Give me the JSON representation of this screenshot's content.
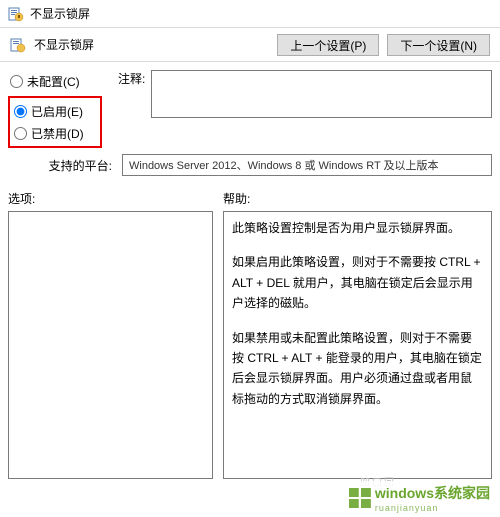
{
  "window": {
    "title": "不显示锁屏",
    "policy_name": "不显示锁屏"
  },
  "nav": {
    "prev": "上一个设置(P)",
    "next": "下一个设置(N)"
  },
  "radios": {
    "not_configured": "未配置(C)",
    "enabled": "已启用(E)",
    "disabled": "已禁用(D)"
  },
  "labels": {
    "comment": "注释:",
    "platform": "支持的平台:",
    "options": "选项:",
    "help": "帮助:"
  },
  "platform_text": "Windows Server 2012、Windows 8 或 Windows RT 及以上版本",
  "help_paragraphs": [
    "此策略设置控制是否为用户显示锁屏界面。",
    "如果启用此策略设置，则对于不需要按 CTRL + ALT + DEL 就用户，其电脑在锁定后会显示用户选择的磁贴。",
    "如果禁用或未配置此策略设置，则对于不需要按 CTRL + ALT + 能登录的用户，其电脑在锁定后会显示锁屏界面。用户必须通过盘或者用鼠标拖动的方式取消锁屏界面。"
  ],
  "watermark": {
    "text": "windows系统家园",
    "sub": "ruanjianyuan"
  },
  "badge": "凹口回"
}
